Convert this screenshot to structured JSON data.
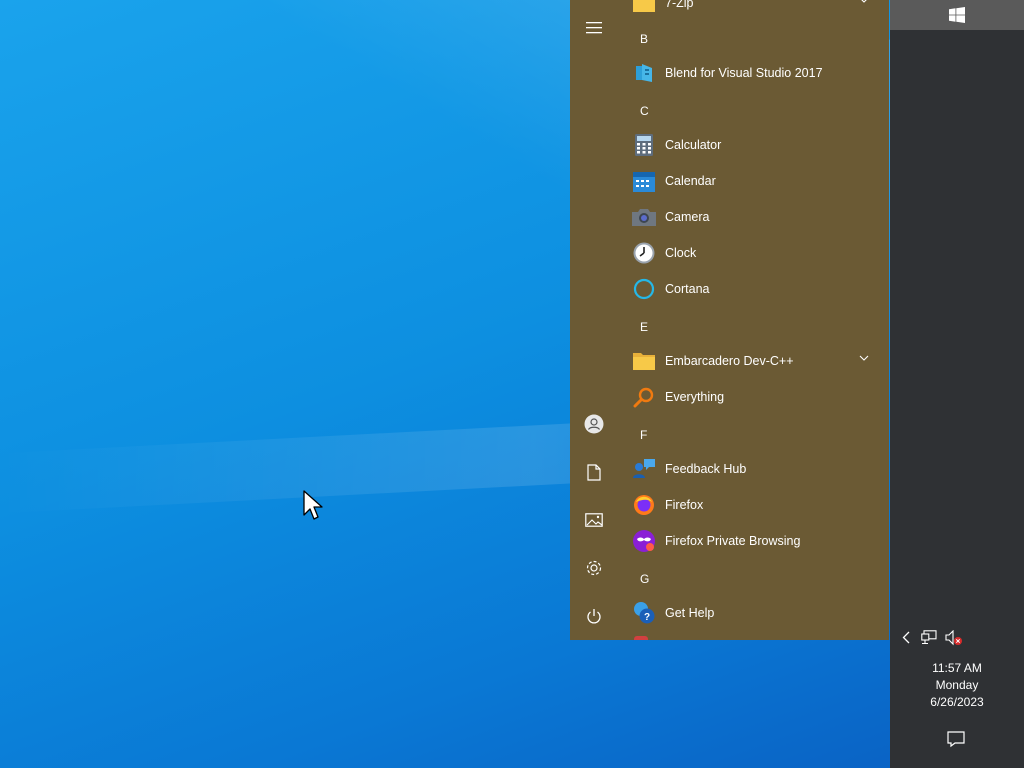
{
  "start_menu": {
    "rail": [
      {
        "icon": "hamburger-menu-icon"
      },
      {
        "icon": "user-icon"
      },
      {
        "icon": "documents-icon"
      },
      {
        "icon": "pictures-icon"
      },
      {
        "icon": "settings-gear-icon"
      },
      {
        "icon": "power-icon"
      }
    ],
    "top_item": {
      "label": "7-Zip",
      "icon": "folder-icon"
    },
    "letters": {
      "b": "B",
      "c": "C",
      "e": "E",
      "f": "F",
      "g": "G"
    },
    "apps": [
      {
        "label": "Blend for Visual Studio 2017",
        "icon": "blend-icon"
      },
      {
        "label": "Calculator",
        "icon": "calculator-icon"
      },
      {
        "label": "Calendar",
        "icon": "calendar-icon"
      },
      {
        "label": "Camera",
        "icon": "camera-icon"
      },
      {
        "label": "Clock",
        "icon": "clock-icon"
      },
      {
        "label": "Cortana",
        "icon": "cortana-icon"
      },
      {
        "label": "Embarcadero Dev-C++",
        "icon": "folder-icon"
      },
      {
        "label": "Everything",
        "icon": "search-magnifier-icon"
      },
      {
        "label": "Feedback Hub",
        "icon": "feedback-icon"
      },
      {
        "label": "Firefox",
        "icon": "firefox-icon"
      },
      {
        "label": "Firefox Private Browsing",
        "icon": "firefox-private-icon"
      },
      {
        "label": "Get Help",
        "icon": "help-icon"
      }
    ]
  },
  "taskbar": {
    "start_icon": "windows-logo-icon",
    "tray_icons": [
      "chevron-left-icon",
      "network-icon",
      "volume-muted-icon"
    ],
    "clock": {
      "time": "11:57 AM",
      "day": "Monday",
      "date": "6/26/2023"
    },
    "notification_icon": "action-center-icon"
  },
  "colors": {
    "start_bg": "#6b5a34",
    "taskbar_bg": "#2f3134",
    "accent_desktop": "#0d8fe0"
  }
}
